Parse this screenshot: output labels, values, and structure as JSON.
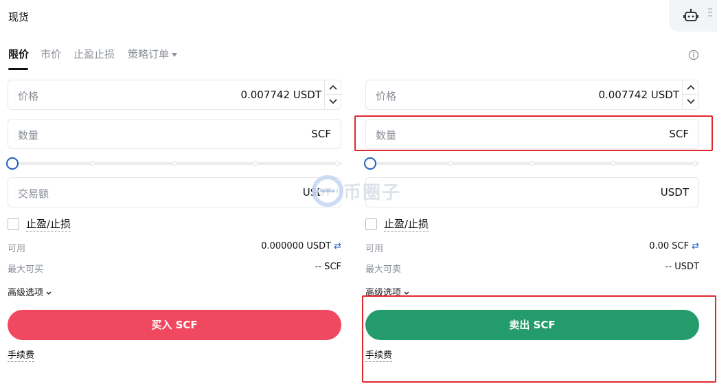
{
  "header": {
    "title": "现货"
  },
  "tabs": [
    {
      "label": "限价",
      "active": true
    },
    {
      "label": "市价",
      "active": false
    },
    {
      "label": "止盈止损",
      "active": false
    },
    {
      "label": "策略订单",
      "active": false
    }
  ],
  "buy": {
    "price_label": "价格",
    "price_value": "0.007742 USDT",
    "amount_label": "数量",
    "amount_unit": "SCF",
    "slider_percent": 0,
    "total_label": "交易额",
    "total_unit": "USDT",
    "tpsl_label": "止盈/止损",
    "available_label": "可用",
    "available_value": "0.000000 USDT",
    "max_label": "最大可买",
    "max_value": "-- SCF",
    "advanced_label": "高级选项",
    "button_label": "买入 SCF",
    "fee_label": "手续费"
  },
  "sell": {
    "price_label": "价格",
    "price_value": "0.007742 USDT",
    "amount_label": "数量",
    "amount_unit": "SCF",
    "slider_percent": 0,
    "total_unit": "USDT",
    "tpsl_label": "止盈/止损",
    "available_label": "可用",
    "available_value": "0.00 SCF",
    "max_label": "最大可卖",
    "max_value": "-- USDT",
    "advanced_label": "高级选项",
    "button_label": "卖出 SCF",
    "fee_label": "手续费"
  },
  "watermark": {
    "text": "币圈子"
  },
  "colors": {
    "buy": "#f0495f",
    "sell": "#249b6b",
    "accent": "#1d5fbf",
    "highlight": "#e0282e"
  },
  "icons": [
    "robot-icon",
    "menu-dots-icon",
    "info-icon",
    "chevron-up-icon",
    "chevron-down-icon",
    "swap-icon"
  ]
}
